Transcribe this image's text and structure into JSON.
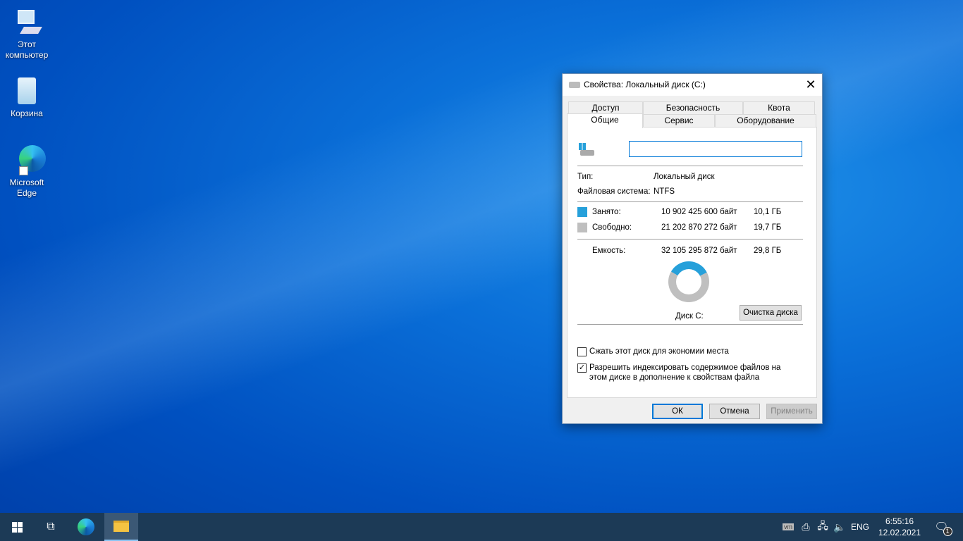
{
  "desktop": {
    "icons": [
      {
        "label": "Этот компьютер",
        "icon": "computer-icon"
      },
      {
        "label": "Корзина",
        "icon": "recycle-bin-icon"
      },
      {
        "label": "Microsoft Edge",
        "icon": "edge-icon"
      }
    ]
  },
  "dialog": {
    "title": "Свойства: Локальный диск (C:)",
    "tabs_row1": [
      "Доступ",
      "Безопасность",
      "Квота"
    ],
    "tabs_row2": [
      "Общие",
      "Сервис",
      "Оборудование"
    ],
    "active_tab": "Общие",
    "name_value": "",
    "type_label": "Тип:",
    "type_value": "Локальный диск",
    "fs_label": "Файловая система:",
    "fs_value": "NTFS",
    "used_label": "Занято:",
    "used_bytes": "10 902 425 600 байт",
    "used_gb": "10,1 ГБ",
    "free_label": "Свободно:",
    "free_bytes": "21 202 870 272 байт",
    "free_gb": "19,7 ГБ",
    "capacity_label": "Емкость:",
    "capacity_bytes": "32 105 295 872 байт",
    "capacity_gb": "29,8 ГБ",
    "used_fraction": 0.34,
    "used_color": "#26a0da",
    "free_color": "#bfbfbf",
    "disk_label": "Диск C:",
    "cleanup_button": "Очистка диска",
    "compress_label": "Сжать этот диск для экономии места",
    "compress_checked": false,
    "index_label_1": "Разрешить индексировать содержимое файлов на",
    "index_label_2": "этом диске в дополнение к свойствам файла",
    "index_checked": true,
    "ok": "ОК",
    "cancel": "Отмена",
    "apply": "Применить"
  },
  "taskbar": {
    "tray": {
      "vm": "vm",
      "lang": "ENG",
      "time": "6:55:16",
      "date": "12.02.2021",
      "notifications": "1"
    }
  }
}
